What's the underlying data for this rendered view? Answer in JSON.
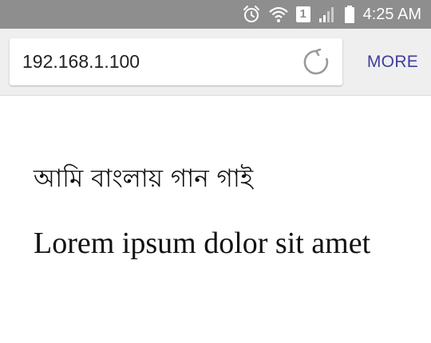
{
  "status_bar": {
    "time": "4:25 AM",
    "sim_slot": "1",
    "icons": [
      "alarm-icon",
      "wifi-icon",
      "sim-icon",
      "signal-icon",
      "battery-icon"
    ]
  },
  "browser": {
    "url": "192.168.1.100",
    "more_label": "MORE",
    "accent_color": "#3f3d9e"
  },
  "page": {
    "bangla_text": "আমি বাংলায় গান গাই",
    "lorem_text": "Lorem ipsum dolor sit amet"
  }
}
